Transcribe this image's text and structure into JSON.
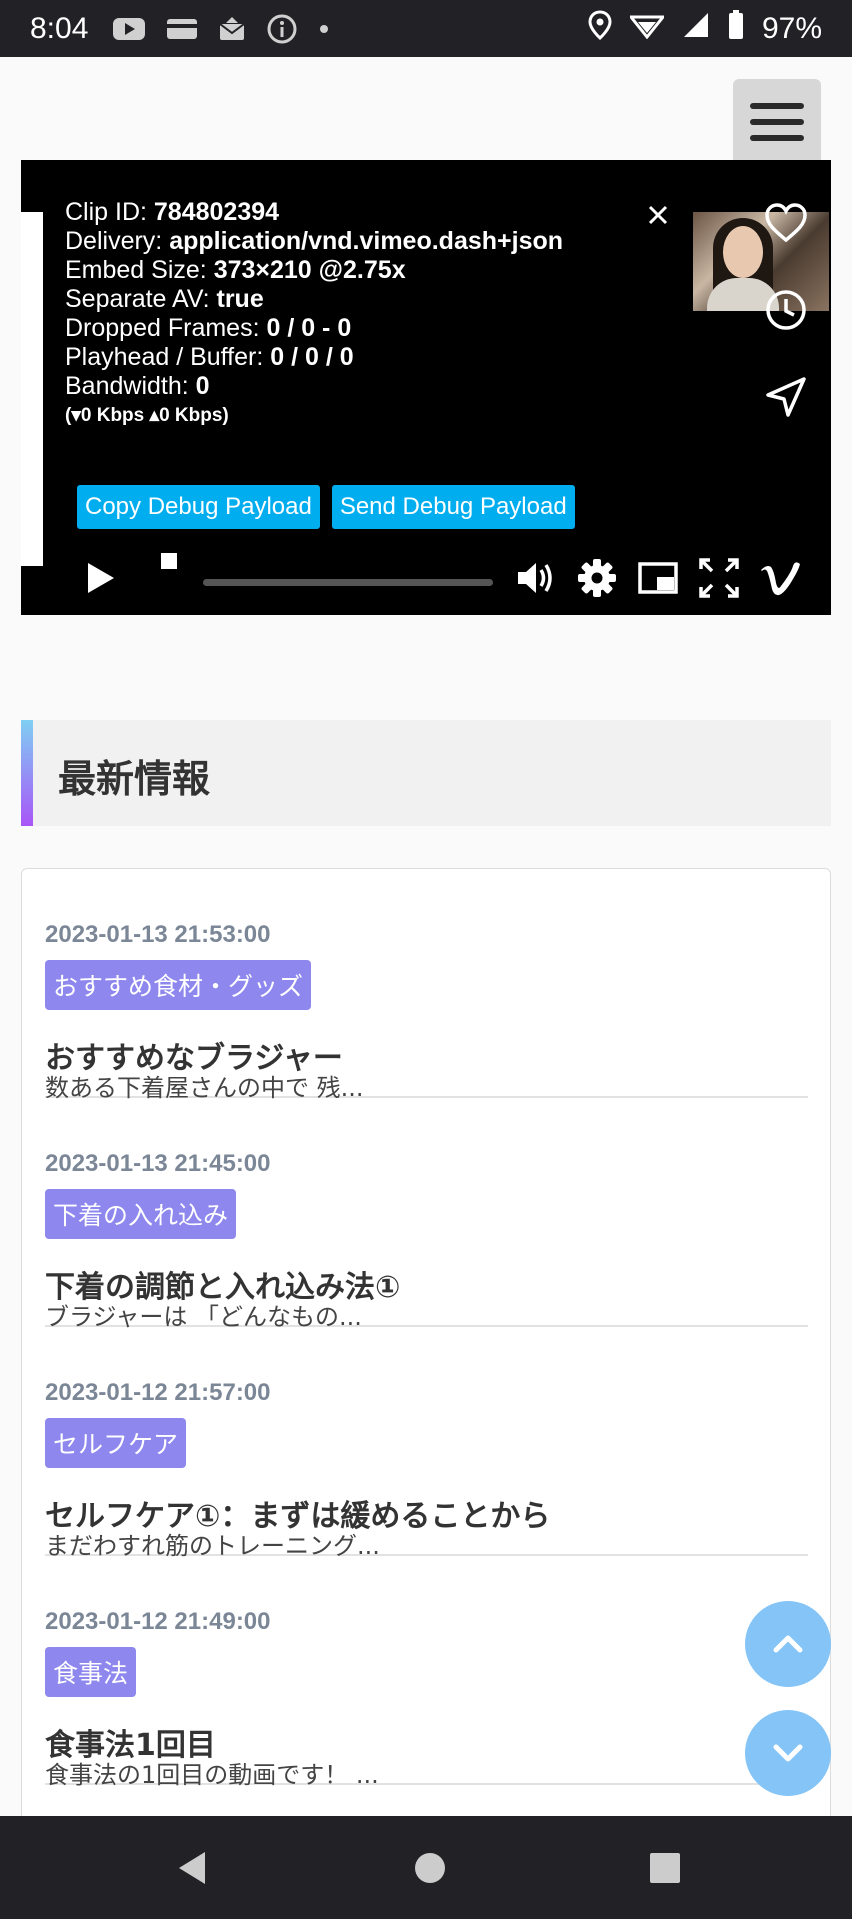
{
  "status_bar": {
    "time": "8:04",
    "battery": "97%",
    "icons": [
      "youtube-icon",
      "card-icon",
      "mail-icon",
      "info-icon",
      "dot-icon",
      "location-icon",
      "wifi-icon",
      "signal-icon",
      "battery-icon"
    ]
  },
  "menu": {
    "icon": "hamburger-icon"
  },
  "player": {
    "debug": {
      "clip_id_label": "Clip ID: ",
      "clip_id": "784802394",
      "delivery_label": "Delivery: ",
      "delivery": "application/vnd.vimeo.dash+json",
      "embed_label": "Embed Size: ",
      "embed": "373×210 @2.75x",
      "separate_av_label": "Separate AV: ",
      "separate_av": "true",
      "dropped_label": "Dropped Frames: ",
      "dropped": "0 / 0 - 0",
      "playhead_label": "Playhead / Buffer: ",
      "playhead": "0 / 0 / 0",
      "bandwidth_label": "Bandwidth: ",
      "bandwidth": "0",
      "open_paren": "(",
      "down_rate": "0 Kbps",
      "up_rate": "0 Kbps",
      "close_paren": ")",
      "copy_button": "Copy Debug Payload",
      "send_button": "Send Debug Payload"
    },
    "progress": 0,
    "side_icons": [
      "heart-icon",
      "clock-icon",
      "share-icon"
    ],
    "control_icons": [
      "play-icon",
      "stop-icon",
      "volume-icon",
      "settings-icon",
      "pip-icon",
      "fullscreen-icon",
      "vimeo-logo"
    ]
  },
  "section": {
    "title": "最新情報"
  },
  "news": [
    {
      "date": "2023-01-13 21:53:00",
      "tag": "おすすめ食材・グッズ",
      "title": "おすすめなブラジャー",
      "desc": "数ある下着屋さんの中で 残..."
    },
    {
      "date": "2023-01-13 21:45:00",
      "tag": "下着の入れ込み",
      "title": "下着の調節と入れ込み法①",
      "desc": "ブラジャーは 「どんなもの..."
    },
    {
      "date": "2023-01-12 21:57:00",
      "tag": "セルフケア",
      "title": "セルフケア①：まずは緩めることから",
      "desc": "まだわすれ筋のトレーニング..."
    },
    {
      "date": "2023-01-12 21:49:00",
      "tag": "食事法",
      "title": "食事法1回目",
      "desc": "食事法の1回目の動画です！ ..."
    }
  ],
  "fab": {
    "up": "chevron-up-icon",
    "down": "chevron-down-icon"
  },
  "colors": {
    "tag_bg": "#8e87ee",
    "debug_button": "#00adef",
    "fab": "#84c4f6",
    "accent_gradient_top": "#7fcff3",
    "accent_gradient_bottom": "#a855f7"
  }
}
